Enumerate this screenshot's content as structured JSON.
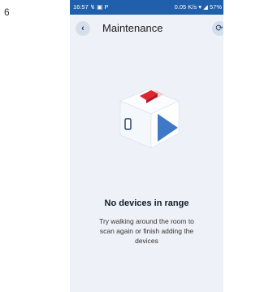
{
  "page_number": "6",
  "status_bar": {
    "time": "16:57",
    "left_icons": "↯ ▣ P",
    "network_speed": "0.05 K/s",
    "battery": "57%"
  },
  "header": {
    "title": "Maintenance"
  },
  "icons": {
    "back": "chevron-left-icon",
    "refresh": "refresh-icon"
  },
  "empty_state": {
    "title": "No devices in range",
    "message": "Try walking around the room to scan again or finish adding the devices"
  },
  "colors": {
    "status_bar": "#1f5fab",
    "background": "#eef2f8",
    "accent_red": "#e0242d",
    "accent_blue": "#3f78c6"
  }
}
